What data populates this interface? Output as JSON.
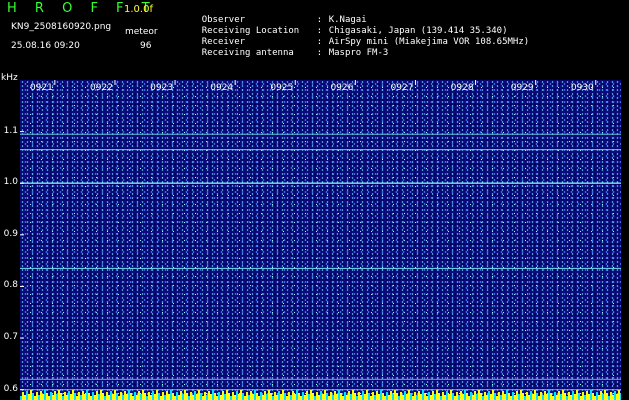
{
  "header": {
    "brand": "H R O F F T",
    "version": "1.0.0f",
    "file_name": "KN9_2508160920.png",
    "timestamp": "25.08.16 09:20",
    "meteor_label": "meteor",
    "meteor_count": "96"
  },
  "meta": {
    "rows": [
      {
        "key": "Observer",
        "value": "K.Nagai"
      },
      {
        "key": "Receiving Location",
        "value": "Chigasaki, Japan (139.414 35.340)"
      },
      {
        "key": "Receiver",
        "value": "AirSpy mini (Miakejima VOR 108.65MHz)"
      },
      {
        "key": "Receiving antenna",
        "value": "Maspro FM-3"
      }
    ]
  },
  "colors": {
    "background": "#000000",
    "waterfall": "#0a0a7a",
    "tone": "#7fffff",
    "brand": "#33ff33",
    "version": "#ffff33",
    "axis": "#ffffff",
    "bottom_strip": "#ffff00"
  },
  "chart_data": {
    "type": "heatmap",
    "xlabel": "",
    "ylabel": "kHz",
    "x_ticks": [
      "0921",
      "0922",
      "0923",
      "0924",
      "0925",
      "0926",
      "0927",
      "0928",
      "0929",
      "0930"
    ],
    "y_ticks": [
      1.1,
      1.0,
      0.9,
      0.8,
      0.7,
      0.6
    ],
    "ylim": [
      0.58,
      1.2
    ],
    "carrier_lines_khz": [
      1.095,
      1.065,
      1.0,
      0.835,
      0.62,
      0.6
    ]
  }
}
